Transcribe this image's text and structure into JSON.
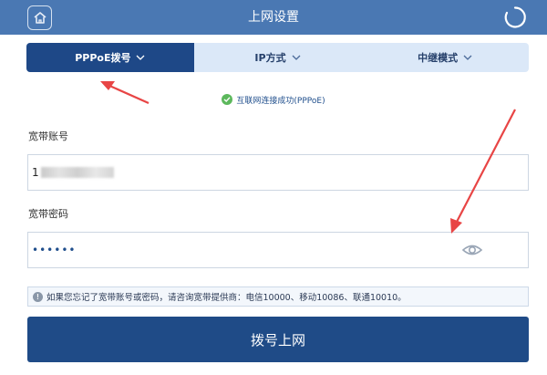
{
  "header": {
    "title": "上网设置",
    "home_icon": "home-icon",
    "refresh_icon": "refresh-icon"
  },
  "tabs": [
    {
      "label": "PPPoE拨号",
      "active": true
    },
    {
      "label": "IP方式",
      "active": false
    },
    {
      "label": "中继模式",
      "active": false
    }
  ],
  "status": {
    "text": "互联网连接成功(PPPoE)",
    "icon": "check-circle-icon"
  },
  "account": {
    "label": "宽带账号",
    "value_visible": "1"
  },
  "password": {
    "label": "宽带密码",
    "value": "••••••",
    "toggle_icon": "eye-icon"
  },
  "tip": {
    "text": "如果您忘记了宽带账号或密码，请咨询宽带提供商：电信10000、移动10086、联通10010。",
    "icon": "info-icon"
  },
  "submit": {
    "label": "拨号上网"
  },
  "colors": {
    "header_bg": "#4a78b3",
    "tab_active": "#1e4887",
    "tab_inactive": "#dbe8f8",
    "button": "#1f4b87",
    "annotation_arrow": "#e84545",
    "success": "#5cb85c"
  }
}
